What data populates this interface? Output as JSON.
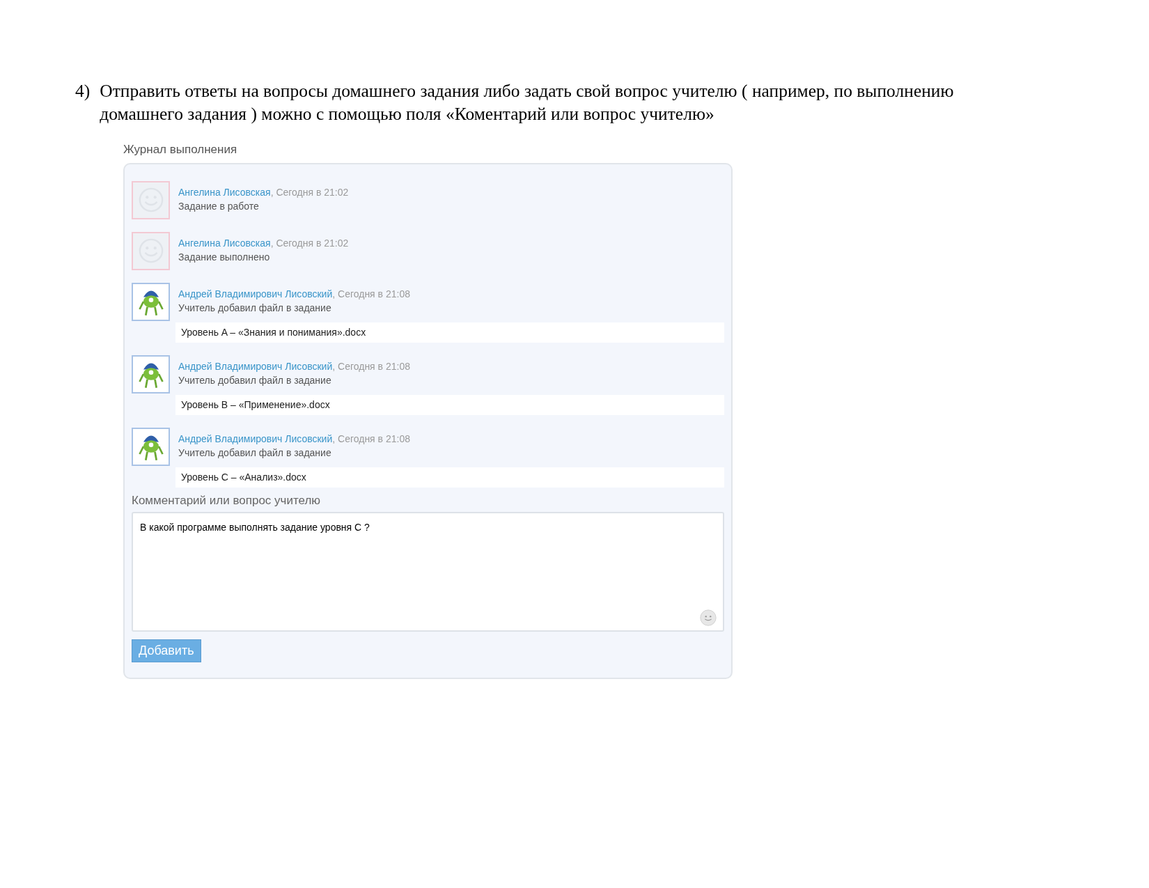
{
  "instruction": {
    "number": "4)",
    "text": "Отправить ответы на вопросы домашнего задания либо задать свой вопрос учителю ( например, по выполнению домашнего задания ) можно с помощью поля «Коментарий или вопрос учителю»"
  },
  "journal": {
    "title": "Журнал выполнения",
    "entries": [
      {
        "kind": "placeholder",
        "author": "Ангелина Лисовская",
        "time": ", Сегодня в 21:02",
        "action": "Задание в работе"
      },
      {
        "kind": "placeholder",
        "author": "Ангелина Лисовская",
        "time": ", Сегодня в 21:02",
        "action": "Задание выполнено"
      },
      {
        "kind": "picture",
        "author": "Андрей Владимирович Лисовский",
        "time": ", Сегодня в 21:08",
        "action": "Учитель добавил файл в задание",
        "file": "Уровень A – «Знания и понимания».docx"
      },
      {
        "kind": "picture",
        "author": "Андрей Владимирович Лисовский",
        "time": ", Сегодня в 21:08",
        "action": "Учитель добавил файл в задание",
        "file": "Уровень B – «Применение».docx"
      },
      {
        "kind": "picture",
        "author": "Андрей Владимирович Лисовский",
        "time": ", Сегодня в 21:08",
        "action": "Учитель добавил файл в задание",
        "file": "Уровень C – «Анализ».docx"
      }
    ],
    "comment": {
      "label": "Комментарий или вопрос учителю",
      "value": "В какой программе выполнять задание уровня С ?"
    },
    "submit": "Добавить"
  }
}
